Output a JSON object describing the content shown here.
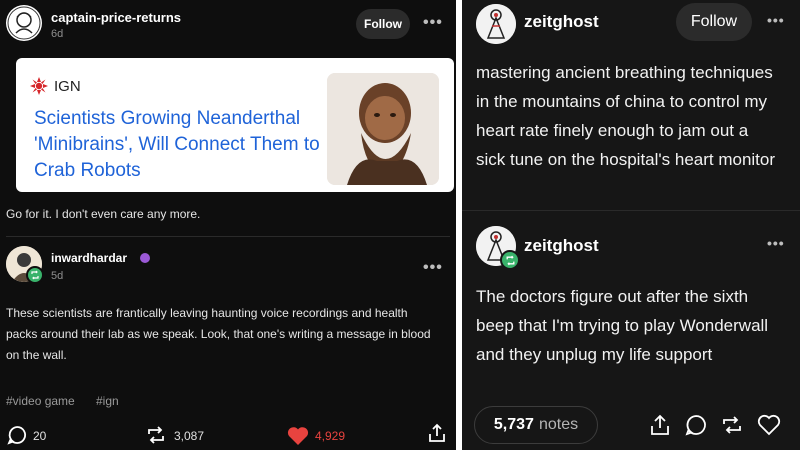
{
  "left_post": {
    "author": "captain-price-returns",
    "age": "6d",
    "follow_label": "Follow",
    "more_label": "•••",
    "link_card": {
      "source": "IGN",
      "headline": "Scientists Growing Neanderthal 'Minibrains', Will Connect Them to Crab Robots"
    },
    "caption": "Go for it. I don't even care any more.",
    "reblog": {
      "author": "inwardhardar",
      "age": "5d",
      "more_label": "•••",
      "text": "These scientists are frantically leaving haunting voice recordings and health packs around their lab as we speak. Look, that one's writing a message in blood on the wall."
    },
    "tags": [
      "#video game",
      "#ign"
    ],
    "footer": {
      "comments": "20",
      "reblogs": "3,087",
      "likes": "4,929"
    },
    "colors": {
      "like_red": "#e8433f",
      "link_blue": "#1f63d8",
      "ign_red": "#d6262a",
      "reblog_green": "#39b36b"
    }
  },
  "right_post": {
    "author": "zeitghost",
    "follow_label": "Follow",
    "more_label": "•••",
    "text": "mastering ancient breathing techniques in the mountains of china to control my heart rate finely enough to jam out a sick tune on the hospital's heart monitor",
    "reblog": {
      "author": "zeitghost",
      "more_label": "•••",
      "text": "The doctors figure out after the sixth beep that I'm trying to play Wonderwall and they unplug my life support"
    },
    "notes_count": "5,737",
    "notes_label": "notes"
  }
}
